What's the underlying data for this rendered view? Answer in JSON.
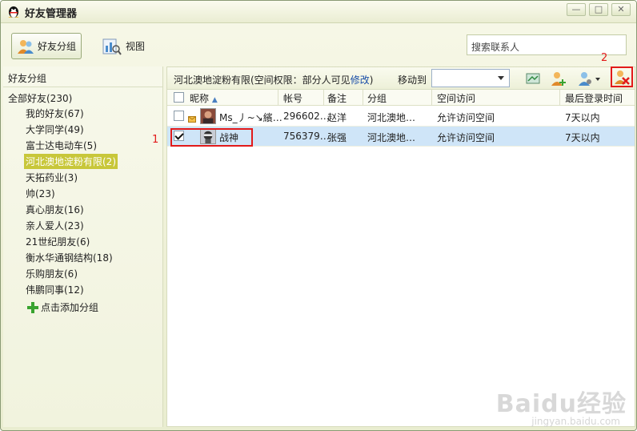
{
  "window": {
    "title": "好友管理器",
    "minimize": "—",
    "maximize": "□",
    "close": "✕"
  },
  "toolbar": {
    "friend_groups_label": "好友分组",
    "view_label": "视图"
  },
  "search": {
    "placeholder": "搜索联系人"
  },
  "sidebar": {
    "header": "好友分组",
    "root": "全部好友(230)",
    "items": [
      "我的好友(67)",
      "大学同学(49)",
      "富士达电动车(5)",
      "河北澳地淀粉有限(2)",
      "天拓药业(3)",
      "帅(23)",
      "真心朋友(16)",
      "亲人爱人(23)",
      "21世纪朋友(6)",
      "衡水华通钢结构(18)",
      "乐购朋友(6)",
      "伟鹏同事(12)"
    ],
    "selected_index": 3,
    "add_group": "点击添加分组"
  },
  "main": {
    "group_info_prefix": "河北澳地淀粉有限(空间权限：部分人可见",
    "group_info_link": "修改",
    "group_info_suffix": ")",
    "move_to_label": "移动到"
  },
  "table": {
    "columns": {
      "nickname": "昵称",
      "account": "帐号",
      "remark": "备注",
      "group": "分组",
      "space": "空间访问",
      "last_login": "最后登录时间"
    },
    "sort_indicator": "▲",
    "rows": [
      {
        "checked": false,
        "nickname": "Ms_丿~↘繽…",
        "account": "296602…",
        "remark": "赵洋",
        "group": "河北澳地…",
        "space": "允许访问空间",
        "last_login": "7天以内"
      },
      {
        "checked": true,
        "nickname": "战神",
        "account": "756379…",
        "remark": "张强",
        "group": "河北澳地…",
        "space": "允许访问空间",
        "last_login": "7天以内"
      }
    ]
  },
  "annotations": {
    "one": "1",
    "two": "2"
  },
  "watermark": {
    "main": "Baidu经验",
    "sub": "jingyan.baidu.com"
  },
  "colors": {
    "highlight": "#c8c73a",
    "selection": "#cfe5f8",
    "annotation": "#e21a1a"
  }
}
